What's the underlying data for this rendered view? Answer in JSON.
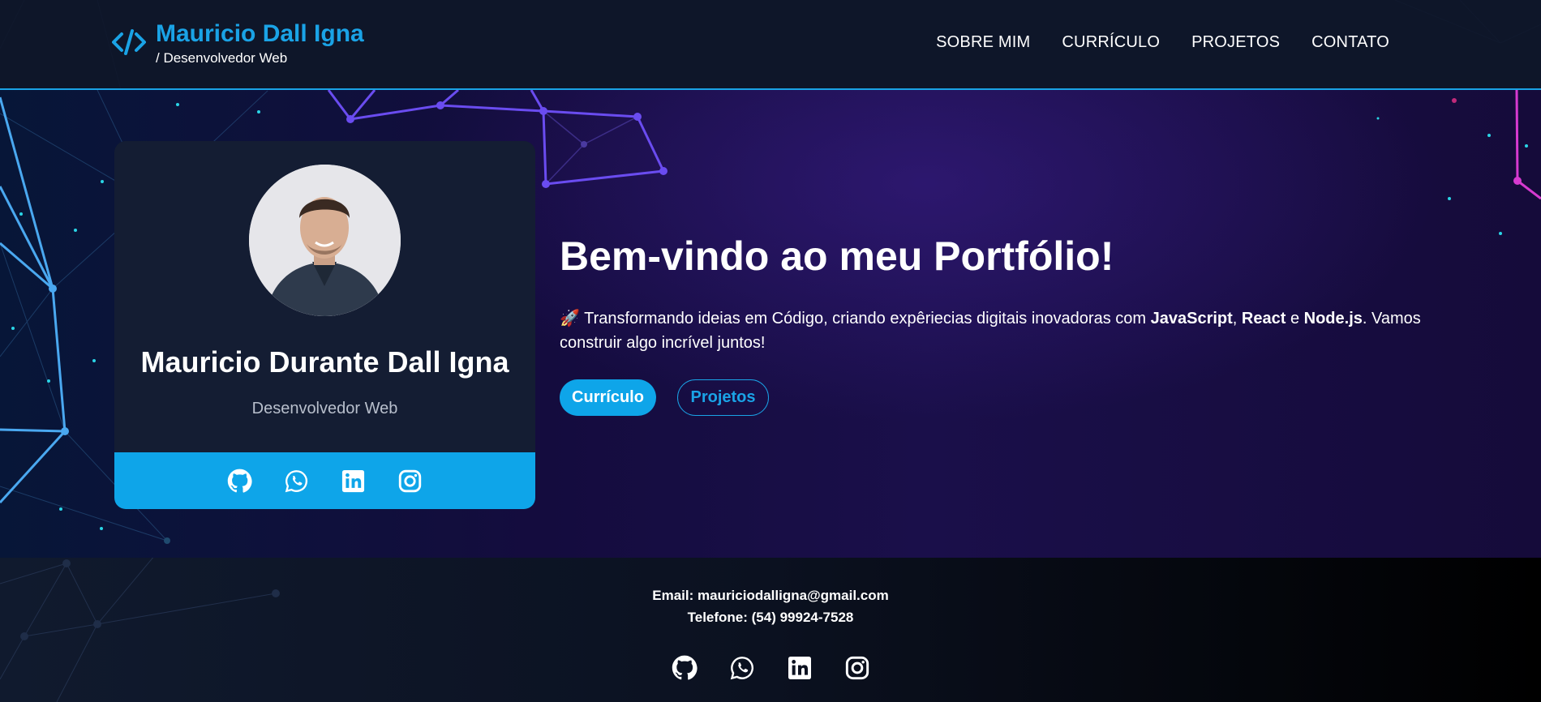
{
  "header": {
    "brand_title": "Mauricio Dall Igna",
    "brand_subtitle": "/ Desenvolvedor Web",
    "nav": [
      "SOBRE MIM",
      "CURRÍCULO",
      "PROJETOS",
      "CONTATO"
    ]
  },
  "profile": {
    "name": "Mauricio Durante Dall Igna",
    "role": "Desenvolvedor Web",
    "social_icons": [
      "github-icon",
      "whatsapp-icon",
      "linkedin-icon",
      "instagram-icon"
    ]
  },
  "hero": {
    "title": "Bem-vindo ao meu Portfólio!",
    "intro_emoji": "🚀",
    "intro_part1": " Transformando ideias em Código, criando expêriecias digitais inovadoras com ",
    "tech1": "JavaScript",
    "sep1": ", ",
    "tech2": "React",
    "sep2": " e ",
    "tech3": "Node.js",
    "intro_part2": ". Vamos construir algo incrível juntos!",
    "btn_primary": "Currículo",
    "btn_secondary": "Projetos"
  },
  "footer": {
    "email": "Email: mauriciodalligna@gmail.com",
    "phone": "Telefone: (54) 99924-7528"
  },
  "colors": {
    "accent": "#0ea5e9",
    "header_bg": "#0f172a",
    "card_bg": "#141d33"
  }
}
